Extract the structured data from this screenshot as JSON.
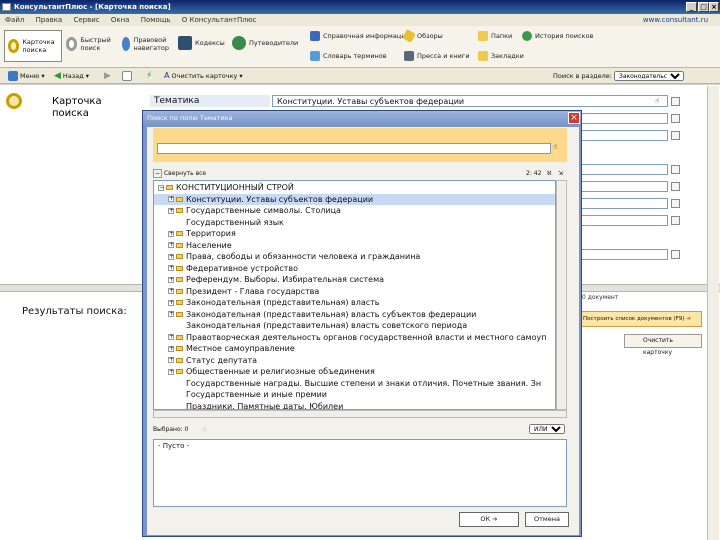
{
  "window": {
    "title": "КонсультантПлюс - [Карточка поиска]",
    "version_link": "www.consultant.ru"
  },
  "menu": [
    "Файл",
    "Правка",
    "Сервис",
    "Окна",
    "Помощь",
    "О КонсультантПлюс"
  ],
  "toolbar": {
    "search_card": "Карточка поиска",
    "quick_search": "Быстрый поиск",
    "legal_navigator": "Правовой навигатор",
    "codes": "Кодексы",
    "guide": "Путеводители",
    "reference_info": "Справочная информация",
    "dictionary": "Словарь терминов",
    "reviews": "Обзоры",
    "press_and_books": "Пресса и книги",
    "folders": "Папки",
    "bookmarks": "Закладки",
    "search_history": "История поисков"
  },
  "toolbar2": {
    "menu": "Меню",
    "back": "Назад",
    "clear_card": "Очистить карточку",
    "search_in_section": "Поиск в разделе:",
    "section_value": "Законодательство"
  },
  "card": {
    "title": "Карточка поиска",
    "results_label": "Результаты поиска:",
    "field_label": "Тематика",
    "field_value": "Конституции. Уставы субъектов федерации",
    "docs_found": "0 документ",
    "build_list_button": "Построить список документов (F9)",
    "clear_card_button": "Очистить карточку"
  },
  "dialog": {
    "title": "Поиск по полю Тематика",
    "collapse_all": "Свернуть все",
    "counter": "2: 42",
    "selected": "Выбрано: 0",
    "logic": "ИЛИ",
    "empty": "- Пусто -",
    "ok": "ОК",
    "cancel": "Отмена",
    "tree": [
      {
        "text": "КОНСТИТУЦИОННЫЙ СТРОЙ",
        "level": 0,
        "exp": "−",
        "folder": true
      },
      {
        "text": "Конституции. Уставы субъектов федерации",
        "level": 1,
        "exp": "+",
        "folder": true,
        "selected": true
      },
      {
        "text": "Государственные символы. Столица",
        "level": 1,
        "exp": "+",
        "folder": true
      },
      {
        "text": "Государственный язык",
        "level": 1,
        "exp": "",
        "folder": false
      },
      {
        "text": "Территория",
        "level": 1,
        "exp": "+",
        "folder": true
      },
      {
        "text": "Население",
        "level": 1,
        "exp": "+",
        "folder": true
      },
      {
        "text": "Права, свободы и обязанности человека и гражданина",
        "level": 1,
        "exp": "+",
        "folder": true
      },
      {
        "text": "Федеративное устройство",
        "level": 1,
        "exp": "+",
        "folder": true
      },
      {
        "text": "Референдум. Выборы. Избирательная система",
        "level": 1,
        "exp": "+",
        "folder": true
      },
      {
        "text": "Президент - Глава государства",
        "level": 1,
        "exp": "+",
        "folder": true
      },
      {
        "text": "Законодательная (представительная) власть",
        "level": 1,
        "exp": "+",
        "folder": true
      },
      {
        "text": "Законодательная (представительная) власть субъектов федерации",
        "level": 1,
        "exp": "+",
        "folder": true
      },
      {
        "text": "Законодательная (представительная) власть советского периода",
        "level": 1,
        "exp": "",
        "folder": false
      },
      {
        "text": "Правотворческая деятельность органов государственной власти и местного самоуп",
        "level": 1,
        "exp": "+",
        "folder": true
      },
      {
        "text": "Местное самоуправление",
        "level": 1,
        "exp": "+",
        "folder": true
      },
      {
        "text": "Статус депутата",
        "level": 1,
        "exp": "+",
        "folder": true
      },
      {
        "text": "Общественные и религиозные объединения",
        "level": 1,
        "exp": "+",
        "folder": true
      },
      {
        "text": "Государственные награды. Высшие степени и знаки отличия. Почетные звания. Зн",
        "level": 1,
        "exp": "",
        "folder": false
      },
      {
        "text": "Государственные и иные премии",
        "level": 1,
        "exp": "",
        "folder": false
      },
      {
        "text": "Праздники. Памятные даты. Юбилеи",
        "level": 1,
        "exp": "",
        "folder": false
      }
    ]
  },
  "colors": {
    "titlebar": "#0a246a",
    "dialog_frame": "#7a96c8",
    "search_band": "#fcd98b",
    "selection": "#c6d9f5"
  }
}
